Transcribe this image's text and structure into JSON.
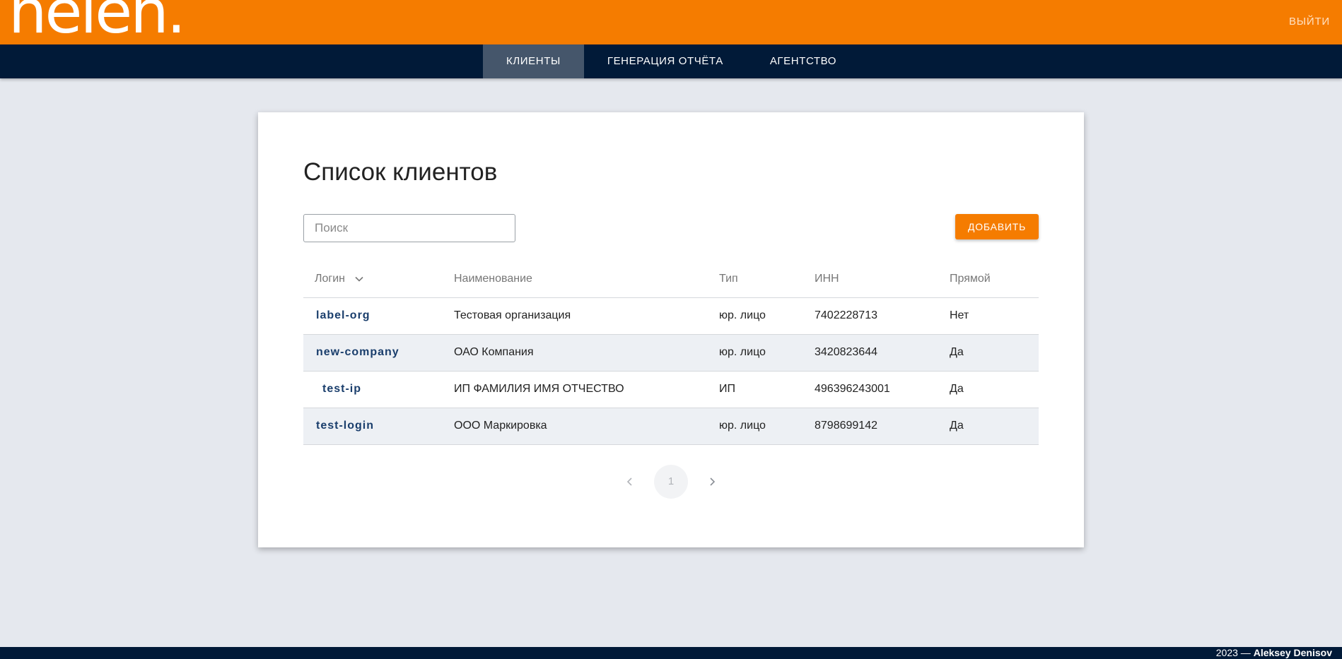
{
  "header": {
    "logo_text": "helen.",
    "logout_label": "Выйти"
  },
  "nav": {
    "tabs": [
      {
        "label": "Клиенты",
        "active": true
      },
      {
        "label": "Генерация отчёта",
        "active": false
      },
      {
        "label": "Агентство",
        "active": false
      }
    ]
  },
  "main": {
    "title": "Список клиентов",
    "search_placeholder": "Поиск",
    "add_button_label": "Добавить",
    "table": {
      "columns": [
        "Логин",
        "Наименование",
        "Тип",
        "ИНН",
        "Прямой"
      ],
      "sort_column": "Логин",
      "sort_icon": "chevron-down-icon",
      "rows": [
        {
          "login": "label-org",
          "name": "Тестовая организация",
          "type": "юр. лицо",
          "inn": "7402228713",
          "direct": "Нет"
        },
        {
          "login": "new-company",
          "name": "ОАО Компания",
          "type": "юр. лицо",
          "inn": "3420823644",
          "direct": "Да"
        },
        {
          "login": "test-ip",
          "name": "ИП ФАМИЛИЯ ИМЯ ОТЧЕСТВО",
          "type": "ИП",
          "inn": "496396243001",
          "direct": "Да"
        },
        {
          "login": "test-login",
          "name": "ООО Маркировка",
          "type": "юр. лицо",
          "inn": "8798699142",
          "direct": "Да"
        }
      ]
    },
    "pagination": {
      "current_page": "1",
      "prev_icon": "chevron-left-icon",
      "next_icon": "chevron-right-icon"
    }
  },
  "footer": {
    "year_text": "2023 —",
    "author": "Aleksey Denisov"
  },
  "colors": {
    "accent": "#f57c00",
    "navbar": "#011a38",
    "active_tab": "#45566b",
    "link": "#1a3e6c",
    "background": "#e5e8ee"
  }
}
